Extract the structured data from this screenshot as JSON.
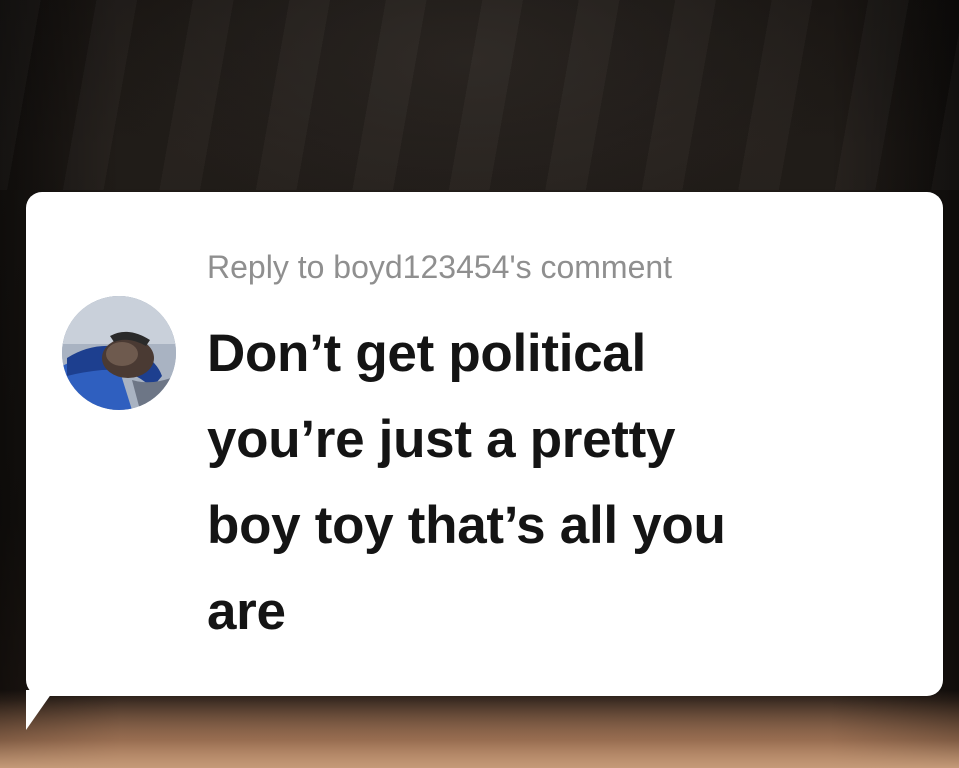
{
  "comment_card": {
    "reply_header": "Reply to boyd123454's comment",
    "avatar_icon": "user-avatar-photo",
    "text_lines": [
      "Don’t get political",
      "you’re just a pretty",
      "boy toy that’s all you",
      "are"
    ]
  },
  "colors": {
    "card_background": "#ffffff",
    "header_text": "#8f8f8f",
    "body_text": "#141414"
  }
}
